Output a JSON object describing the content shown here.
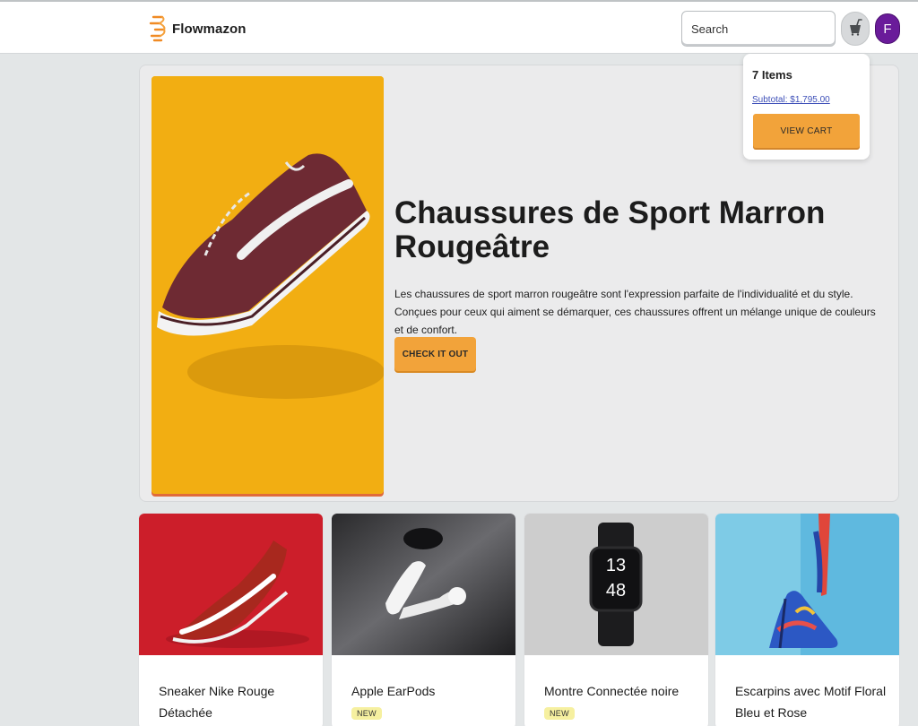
{
  "header": {
    "brand_name": "Flowmazon",
    "search_placeholder": "Search",
    "avatar_initial": "F"
  },
  "hero": {
    "title": "Chaussures de Sport Marron Rougeâtre",
    "description": "Les chaussures de sport marron rougeâtre sont l'expression parfaite de l'individualité et du style. Conçues pour ceux qui aiment se démarquer, ces chaussures offrent un mélange unique de couleurs et de confort.",
    "cta_label": "CHECK IT OUT"
  },
  "cart": {
    "count_label": "7 Items",
    "subtotal_label": "Subtotal: $1,795.00",
    "view_cart_label": "VIEW CART"
  },
  "products": [
    {
      "name": "Sneaker Nike Rouge Détachée",
      "badge": ""
    },
    {
      "name": "Apple EarPods",
      "badge": "NEW"
    },
    {
      "name": "Montre Connectée noire",
      "badge": "NEW"
    },
    {
      "name": "Escarpins avec Motif Floral Bleu et Rose",
      "badge": ""
    }
  ],
  "watch_display": {
    "hours": "13",
    "minutes": "48"
  },
  "colors": {
    "accent": "#f2a33a",
    "avatar": "#6a1b9a",
    "badge": "#f6f0a0",
    "subtotal_link": "#3d4fb8"
  }
}
